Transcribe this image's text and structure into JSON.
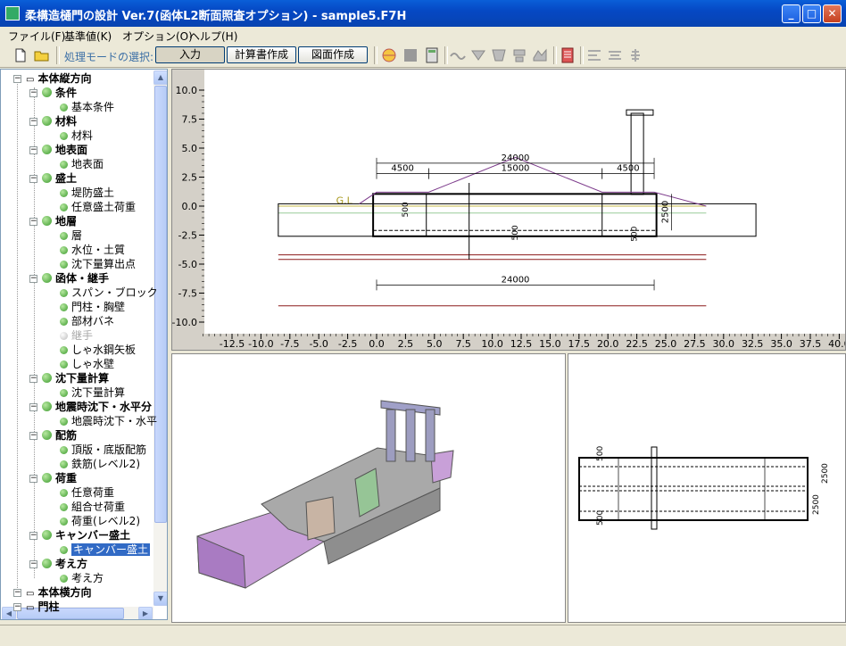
{
  "window": {
    "title": "柔構造樋門の設計 Ver.7(函体L2断面照査オプション) - sample5.F7H"
  },
  "menu": [
    "ファイル(F)",
    "基準値(K)",
    "オプション(O)",
    "ヘルプ(H)"
  ],
  "toolbar": {
    "mode_label": "処理モードの選択:",
    "modes": [
      "入力",
      "計算書作成",
      "図面作成"
    ]
  },
  "tree": {
    "root": "本体縦方向",
    "groups": [
      {
        "label": "条件",
        "items": [
          "基本条件"
        ]
      },
      {
        "label": "材料",
        "items": [
          "材料"
        ]
      },
      {
        "label": "地表面",
        "items": [
          "地表面"
        ]
      },
      {
        "label": "盛土",
        "items": [
          "堤防盛土",
          "任意盛土荷重"
        ]
      },
      {
        "label": "地層",
        "items": [
          "層",
          "水位・土質",
          "沈下量算出点"
        ]
      },
      {
        "label": "函体・継手",
        "items": [
          "スパン・ブロック",
          "門柱・胸壁",
          "部材バネ",
          "継手",
          "しゃ水鋼矢板",
          "しゃ水壁"
        ]
      },
      {
        "label": "沈下量計算",
        "items": [
          "沈下量計算"
        ]
      },
      {
        "label": "地震時沈下・水平分",
        "items": [
          "地震時沈下・水平"
        ]
      },
      {
        "label": "配筋",
        "items": [
          "頂版・底版配筋",
          "鉄筋(レベル2)"
        ]
      },
      {
        "label": "荷重",
        "items": [
          "任意荷重",
          "組合せ荷重",
          "荷重(レベル2)"
        ]
      },
      {
        "label": "キャンバー盛土",
        "items": [
          "キャンバー盛土"
        ]
      },
      {
        "label": "考え方",
        "items": [
          "考え方"
        ]
      }
    ],
    "tail": [
      "本体横方向",
      "門柱"
    ],
    "selected": "キャンバー盛土",
    "disabled": "継手"
  },
  "section_view": {
    "y_ticks": [
      "10.0",
      "7.5",
      "5.0",
      "2.5",
      "0.0",
      "-2.5",
      "-5.0",
      "-7.5",
      "-10.0"
    ],
    "x_ticks": [
      "-12.5",
      "-10.0",
      "-7.5",
      "-5.0",
      "-2.5",
      "0.0",
      "2.5",
      "5.0",
      "7.5",
      "10.0",
      "12.5",
      "15.0",
      "17.5",
      "20.0",
      "22.5",
      "25.0",
      "27.5",
      "30.0",
      "32.5",
      "35.0",
      "37.5",
      "40.0"
    ],
    "dims": {
      "top": "24000",
      "left": "4500",
      "mid": "15000",
      "right": "4500",
      "bottom": "24000",
      "gl": "G.L",
      "h_left": "500",
      "h_center": "500",
      "h_right": "500",
      "height": "2500"
    }
  },
  "cross_view": {
    "dims": {
      "top": "500",
      "bottom": "500",
      "height": "2500",
      "width": "2500"
    }
  },
  "colors": {
    "title_blue": "#0548c4",
    "tree_selected": "#316ac5",
    "embankment": "#7d3c8c",
    "ground": "#8b1a1a",
    "camber": "#c8a0d8"
  }
}
